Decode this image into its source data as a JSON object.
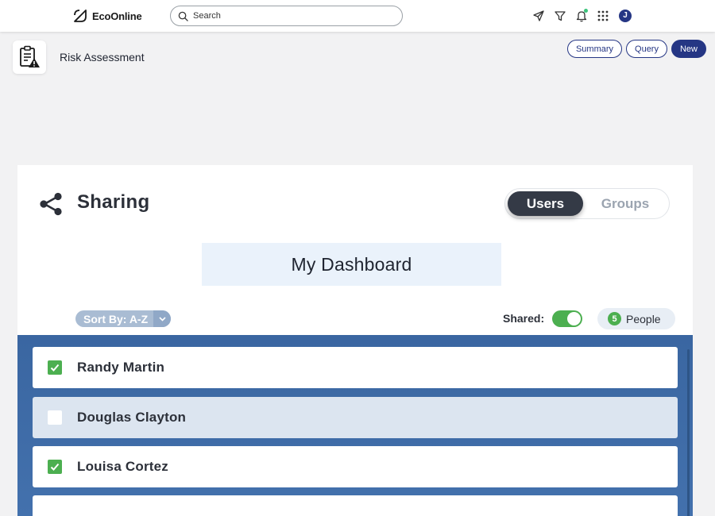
{
  "topbar": {
    "logo_text": "EcoOnline",
    "search_placeholder": "Search",
    "avatar_initial": "J",
    "icons": [
      "rocket-icon",
      "filter-icon",
      "bell-icon",
      "apps-grid-icon"
    ]
  },
  "page": {
    "title": "Risk Assessment",
    "icon": "clipboard-warning-icon",
    "actions": {
      "summary": "Summary",
      "query": "Query",
      "new": "New"
    }
  },
  "sharing": {
    "title": "Sharing",
    "icon": "share-icon",
    "tabs": {
      "users": "Users",
      "groups": "Groups",
      "active": "Users"
    },
    "dashboard_name": "My Dashboard",
    "sort_label": "Sort By: A-Z",
    "shared_label": "Shared:",
    "shared_on": true,
    "people_count": "5",
    "people_label": "People",
    "users": [
      {
        "name": "Randy Martin",
        "checked": true
      },
      {
        "name": "Douglas Clayton",
        "checked": false
      },
      {
        "name": "Louisa Cortez",
        "checked": true
      }
    ]
  },
  "colors": {
    "brand_navy": "#253684",
    "toggle_green": "#4caf50",
    "list_blue": "#3e6aa5"
  }
}
